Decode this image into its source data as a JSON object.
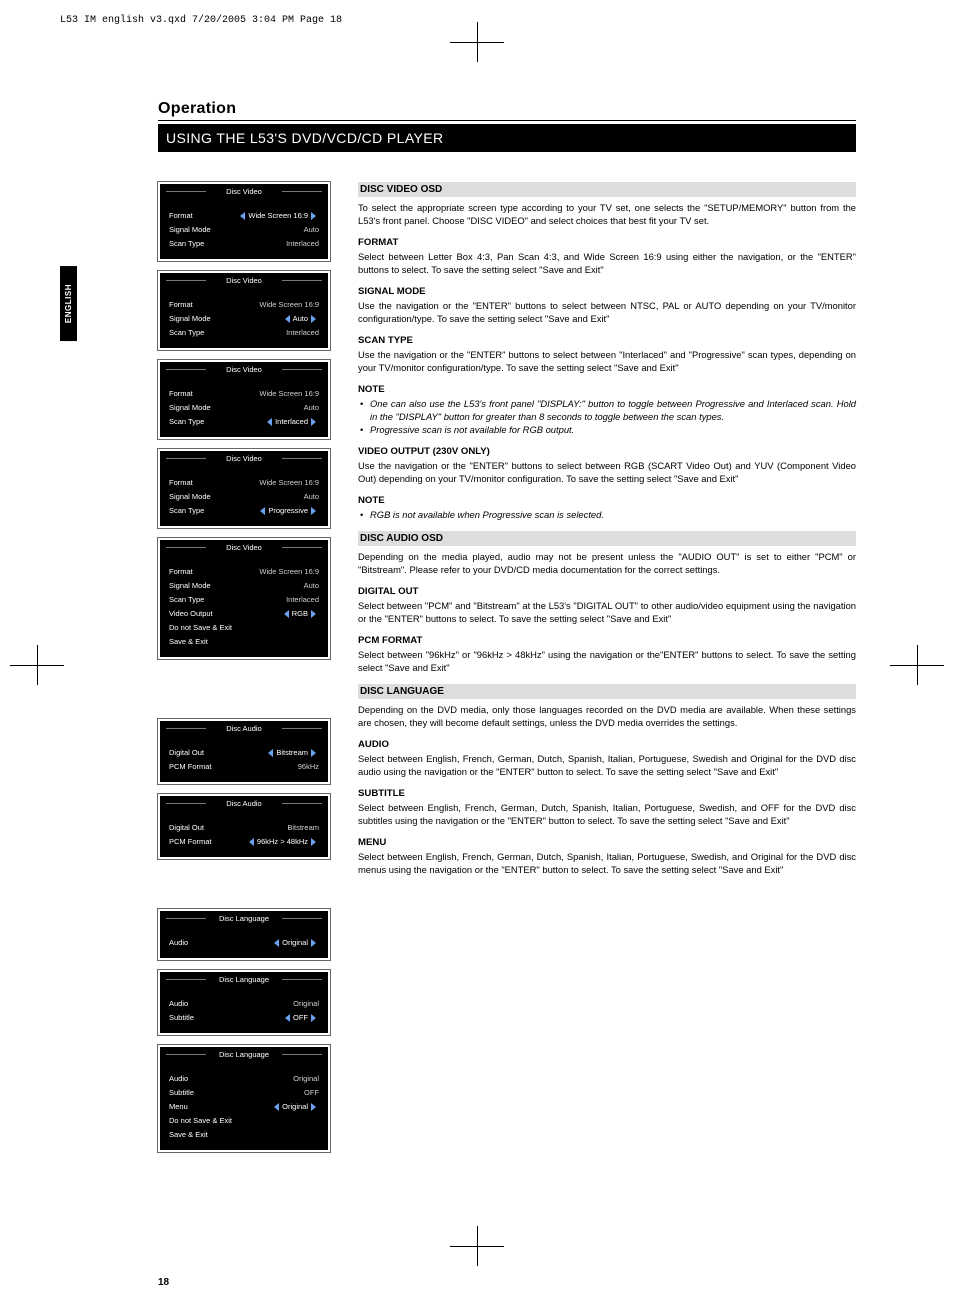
{
  "slug": "L53 IM english v3.qxd  7/20/2005  3:04 PM  Page 18",
  "lang_tab": "ENGLISH",
  "section_title": "Operation",
  "black_bar": "USING THE L53'S DVD/VCD/CD PLAYER",
  "page_num": "18",
  "osd": {
    "video1": {
      "title": "Disc Video",
      "rows": [
        {
          "label": "Format",
          "value": "Wide Screen 16:9",
          "sel": true
        },
        {
          "label": "Signal Mode",
          "value": "Auto"
        },
        {
          "label": "Scan Type",
          "value": "Interlaced"
        }
      ]
    },
    "video2": {
      "title": "Disc Video",
      "rows": [
        {
          "label": "Format",
          "value": "Wide Screen 16:9"
        },
        {
          "label": "Signal Mode",
          "value": "Auto",
          "sel": true
        },
        {
          "label": "Scan Type",
          "value": "Interlaced"
        }
      ]
    },
    "video3": {
      "title": "Disc Video",
      "rows": [
        {
          "label": "Format",
          "value": "Wide Screen 16:9"
        },
        {
          "label": "Signal Mode",
          "value": "Auto"
        },
        {
          "label": "Scan Type",
          "value": "Interlaced",
          "sel": true
        }
      ]
    },
    "video4": {
      "title": "Disc Video",
      "rows": [
        {
          "label": "Format",
          "value": "Wide Screen 16:9"
        },
        {
          "label": "Signal Mode",
          "value": "Auto"
        },
        {
          "label": "Scan Type",
          "value": "Progressive",
          "sel": true
        }
      ]
    },
    "video5": {
      "title": "Disc Video",
      "rows": [
        {
          "label": "Format",
          "value": "Wide Screen 16:9"
        },
        {
          "label": "Signal Mode",
          "value": "Auto"
        },
        {
          "label": "Scan Type",
          "value": "Interlaced"
        },
        {
          "label": "Video Output",
          "value": "RGB",
          "sel": true
        },
        {
          "label": "Do not Save & Exit",
          "value": ""
        },
        {
          "label": "Save & Exit",
          "value": ""
        }
      ]
    },
    "audio1": {
      "title": "Disc Audio",
      "rows": [
        {
          "label": "Digital Out",
          "value": "Bitstream",
          "sel": true
        },
        {
          "label": "PCM Format",
          "value": "96kHz"
        }
      ]
    },
    "audio2": {
      "title": "Disc Audio",
      "rows": [
        {
          "label": "Digital Out",
          "value": "Bitstream"
        },
        {
          "label": "PCM Format",
          "value": "96kHz > 48kHz",
          "sel": true
        }
      ]
    },
    "lang1": {
      "title": "Disc Language",
      "rows": [
        {
          "label": "Audio",
          "value": "Original",
          "sel": true
        }
      ]
    },
    "lang2": {
      "title": "Disc Language",
      "rows": [
        {
          "label": "Audio",
          "value": "Original"
        },
        {
          "label": "Subtitle",
          "value": "OFF",
          "sel": true
        }
      ]
    },
    "lang3": {
      "title": "Disc Language",
      "rows": [
        {
          "label": "Audio",
          "value": "Original"
        },
        {
          "label": "Subtitle",
          "value": "OFF"
        },
        {
          "label": "Menu",
          "value": "Original",
          "sel": true
        },
        {
          "label": "Do not Save & Exit",
          "value": ""
        },
        {
          "label": "Save & Exit",
          "value": ""
        }
      ]
    }
  },
  "text": {
    "disc_video_hd": "DISC VIDEO OSD",
    "disc_video_p": "To select the appropriate screen type according to your TV set, one selects the \"SETUP/MEMORY\" button from the L53's front panel. Choose \"DISC VIDEO\" and select choices that best fit your TV set.",
    "format_hd": "FORMAT",
    "format_p": "Select between Letter Box 4:3, Pan Scan 4:3, and Wide Screen 16:9 using either the navigation, or the \"ENTER\" buttons to select.  To save the setting select \"Save and Exit\"",
    "signal_hd": "SIGNAL MODE",
    "signal_p": "Use the navigation or the \"ENTER\" buttons to select between NTSC, PAL or AUTO depending on your TV/monitor configuration/type.  To save the setting select \"Save and Exit\"",
    "scan_hd": "SCAN TYPE",
    "scan_p": "Use the navigation or the \"ENTER\" buttons to select between \"Interlaced\" and \"Progressive\" scan types, depending on your TV/monitor configuration/type.  To save the setting select \"Save and Exit\"",
    "note_hd": "NOTE",
    "note1_li1": "One can also use the L53's front panel \"DISPLAY:\" button to toggle between Progressive and Interlaced scan.  Hold in the \"DISPLAY\" button for greater than 8 seconds to toggle between the scan types.",
    "note1_li2": "Progressive scan is not available for RGB output.",
    "vout_hd": "VIDEO OUTPUT (230V ONLY)",
    "vout_p": "Use the navigation or the \"ENTER\" buttons to select between RGB (SCART Video Out) and YUV (Component Video Out) depending on your TV/monitor configuration. To save the setting select \"Save and Exit\"",
    "note2_li1": "RGB is not available when Progressive scan is selected.",
    "disc_audio_hd": "DISC AUDIO OSD",
    "disc_audio_p": "Depending on the media played, audio may not be present unless the \"AUDIO OUT\" is set to either \"PCM\" or \"Bitstream\".  Please refer to your DVD/CD media documentation for the correct settings.",
    "digout_hd": "DIGITAL OUT",
    "digout_p": "Select between \"PCM\" and \"Bitstream\" at the L53's \"DIGITAL OUT\" to other audio/video equipment using the navigation or the \"ENTER\" buttons to select.  To save the setting select \"Save and Exit\"",
    "pcm_hd": "PCM FORMAT",
    "pcm_p": "Select between \"96kHz\" or \"96kHz > 48kHz\" using the navigation or the\"ENTER\" buttons to select.  To save the setting select \"Save and Exit\"",
    "disc_lang_hd": "DISC LANGUAGE",
    "disc_lang_p": "Depending on the DVD media, only those languages recorded on the DVD media are available.  When these settings are chosen, they will become default settings, unless the DVD media overrides the settings.",
    "audio_hd": "AUDIO",
    "audio_p": "Select between English, French, German, Dutch, Spanish, Italian, Portuguese, Swedish and Original for the DVD disc audio using the navigation or the \"ENTER\" button to select.  To save the setting select \"Save and Exit\"",
    "sub_hd": "SUBTITLE",
    "sub_p": "Select between English, French, German, Dutch, Spanish, Italian, Portuguese, Swedish, and OFF for the DVD disc subtitles using the navigation or the \"ENTER\" button to select.  To save the setting select \"Save and Exit\"",
    "menu_hd": "MENU",
    "menu_p": "Select between English, French, German, Dutch, Spanish, Italian, Portuguese, Swedish, and Original for the DVD disc menus using the navigation or the \"ENTER\" button to select.  To save the setting select \"Save and Exit\""
  }
}
